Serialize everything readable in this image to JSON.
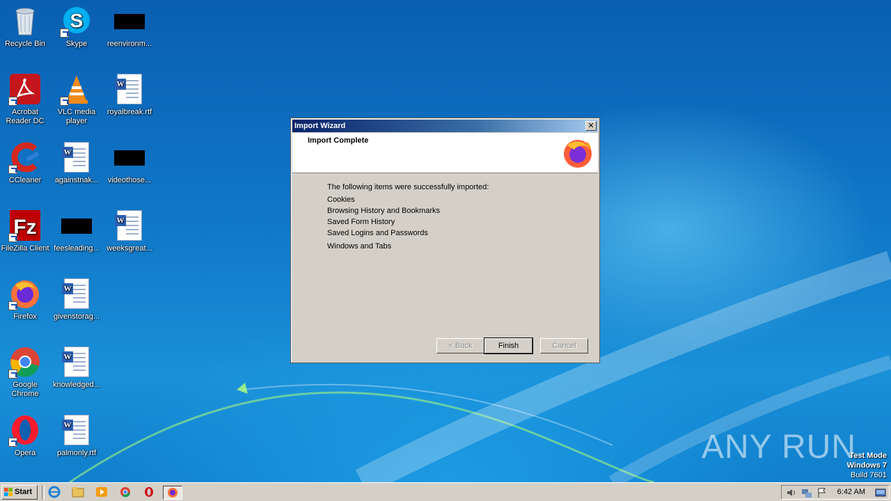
{
  "desktop": {
    "icons": [
      {
        "label": "Recycle Bin",
        "icon": "recycle-bin-icon"
      },
      {
        "label": "Skype",
        "icon": "skype-icon"
      },
      {
        "label": "reenvironm...",
        "icon": "black-thumbnail-icon"
      },
      {
        "label": "Acrobat Reader DC",
        "icon": "acrobat-icon"
      },
      {
        "label": "VLC media player",
        "icon": "vlc-icon"
      },
      {
        "label": "royalbreak.rtf",
        "icon": "word-document-icon"
      },
      {
        "label": "CCleaner",
        "icon": "ccleaner-icon"
      },
      {
        "label": "againstnak...",
        "icon": "word-document-icon"
      },
      {
        "label": "videothose...",
        "icon": "black-thumbnail-icon"
      },
      {
        "label": "FileZilla Client",
        "icon": "filezilla-icon"
      },
      {
        "label": "feesleading...",
        "icon": "black-thumbnail-icon"
      },
      {
        "label": "weeksgreat...",
        "icon": "word-document-icon"
      },
      {
        "label": "Firefox",
        "icon": "firefox-icon"
      },
      {
        "label": "givenstorag...",
        "icon": "word-document-icon"
      },
      {
        "label": "Google Chrome",
        "icon": "chrome-icon"
      },
      {
        "label": "knowledged...",
        "icon": "word-document-icon"
      },
      {
        "label": "Opera",
        "icon": "opera-icon"
      },
      {
        "label": "palmonly.rtf",
        "icon": "word-document-icon"
      }
    ]
  },
  "dialog": {
    "title": "Import Wizard",
    "close_glyph": "✕",
    "header": "Import Complete",
    "intro": "The following items were successfully imported:",
    "items": [
      "Cookies",
      "Browsing History and Bookmarks",
      "Saved Form History",
      "Saved Logins and Passwords",
      "Windows and Tabs"
    ],
    "buttons": {
      "back": "< Back",
      "finish": "Finish",
      "cancel": "Cancel"
    }
  },
  "taskbar": {
    "start_label": "Start",
    "clock": "6:42 AM"
  },
  "watermark": {
    "text": "ANY RUN",
    "test_mode": "Test Mode",
    "os": "Windows 7",
    "build": "Build 7601"
  },
  "colors": {
    "titlebar_start": "#0a246a",
    "dialog_face": "#d4d0c8",
    "desktop_blue": "#1078c8"
  }
}
